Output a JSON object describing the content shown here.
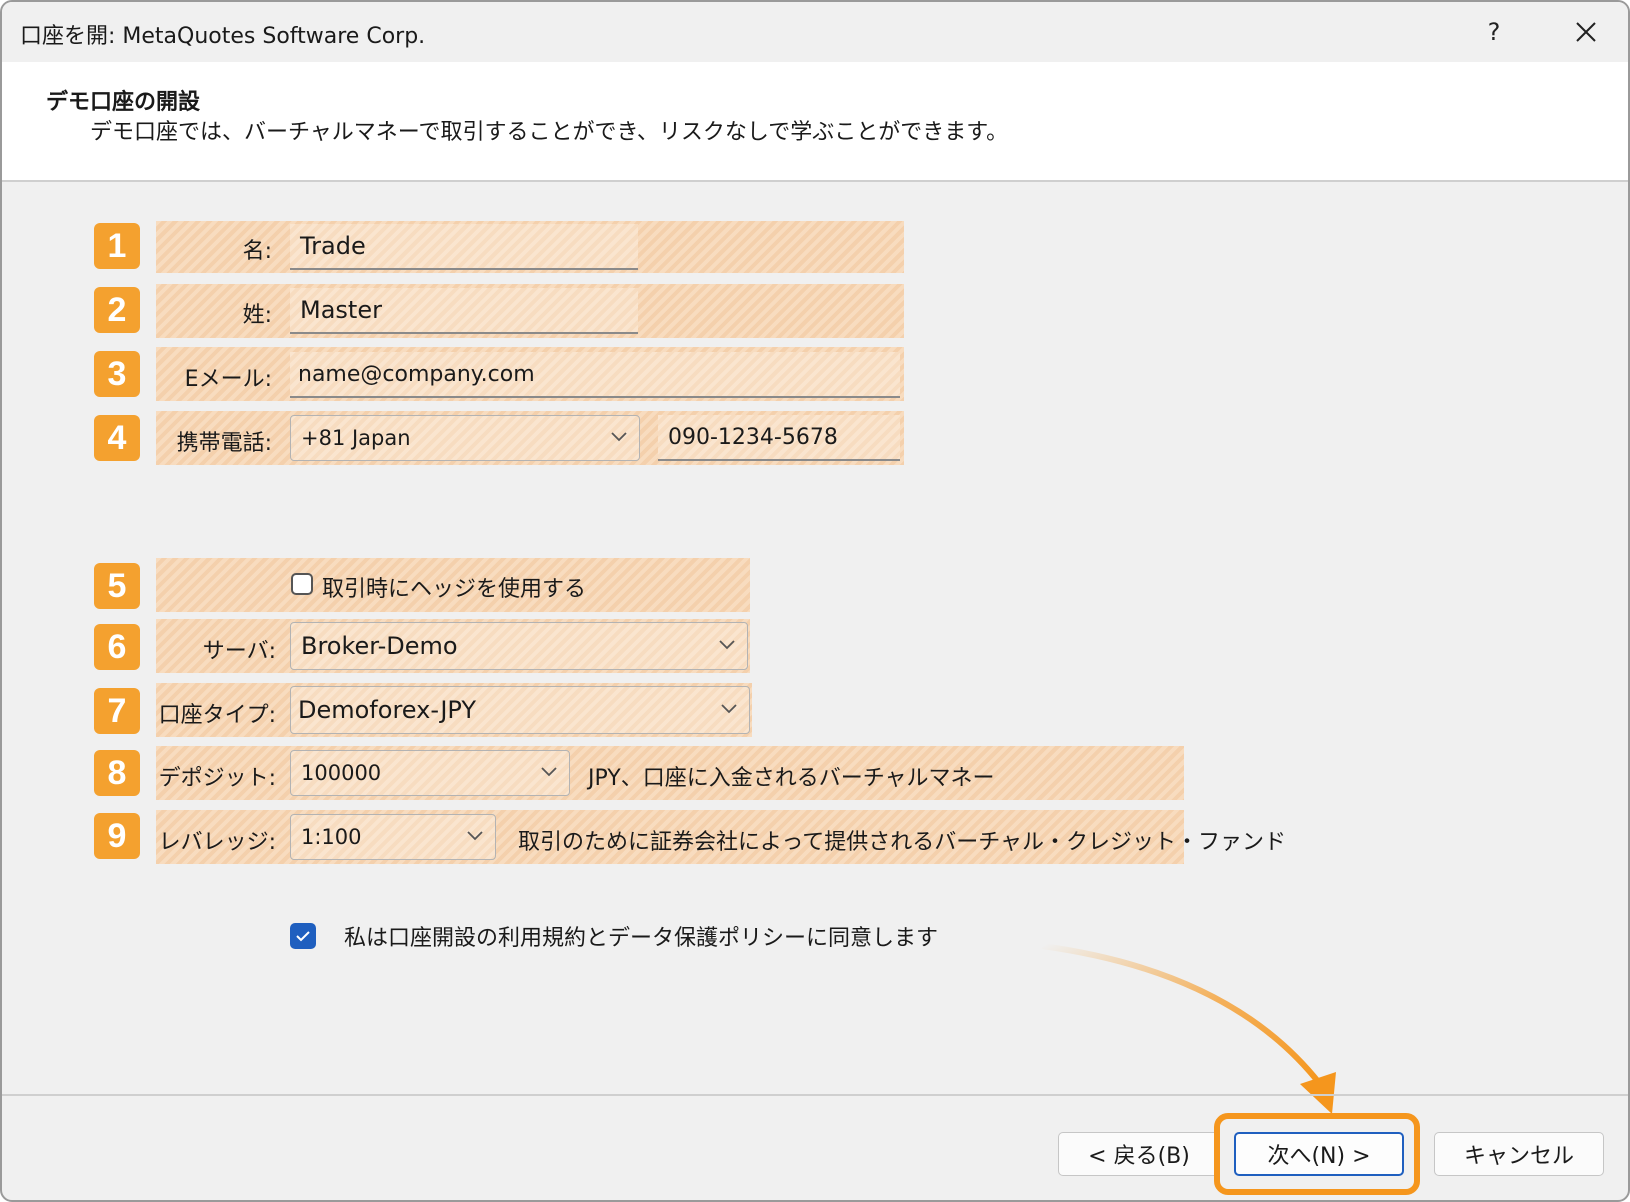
{
  "window": {
    "title": "口座を開: MetaQuotes Software Corp.",
    "help_label": "?"
  },
  "header": {
    "title": "デモ口座の開設",
    "subtitle": "デモ口座では、バーチャルマネーで取引することができ、リスクなしで学ぶことができます。"
  },
  "badges": [
    "1",
    "2",
    "3",
    "4",
    "5",
    "6",
    "7",
    "8",
    "9"
  ],
  "form": {
    "first_name": {
      "label": "名:",
      "value": "Trade"
    },
    "last_name": {
      "label": "姓:",
      "value": "Master"
    },
    "email": {
      "label": "Eメール:",
      "value": "name@company.com"
    },
    "phone": {
      "label": "携帯電話:",
      "country": "+81 Japan",
      "number": "090-1234-5678"
    },
    "hedge": {
      "label": "取引時にヘッジを使用する",
      "checked": false
    },
    "server": {
      "label": "サーバ:",
      "value": "Broker-Demo"
    },
    "account_type": {
      "label": "口座タイプ:",
      "value": "Demoforex-JPY"
    },
    "deposit": {
      "label": "デポジット:",
      "value": "100000",
      "note": "JPY、口座に入金されるバーチャルマネー"
    },
    "leverage": {
      "label": "レバレッジ:",
      "value": "1:100",
      "note": "取引のために証券会社によって提供されるバーチャル・クレジット・ファンド"
    },
    "agree": {
      "label": "私は口座開設の利用規約とデータ保護ポリシーに同意します",
      "checked": true
    }
  },
  "buttons": {
    "back": "< 戻る(B)",
    "next": "次へ(N) >",
    "cancel": "キャンセル"
  },
  "colors": {
    "badge": "#f4a12f",
    "highlight": "#f5961d",
    "accent": "#1f5fbf",
    "field_stripe": "#f8dcbf"
  },
  "icons": {
    "close": "close-icon",
    "dropdown": "chevron-down-icon",
    "check": "check-icon",
    "arrow": "curved-arrow-icon"
  }
}
